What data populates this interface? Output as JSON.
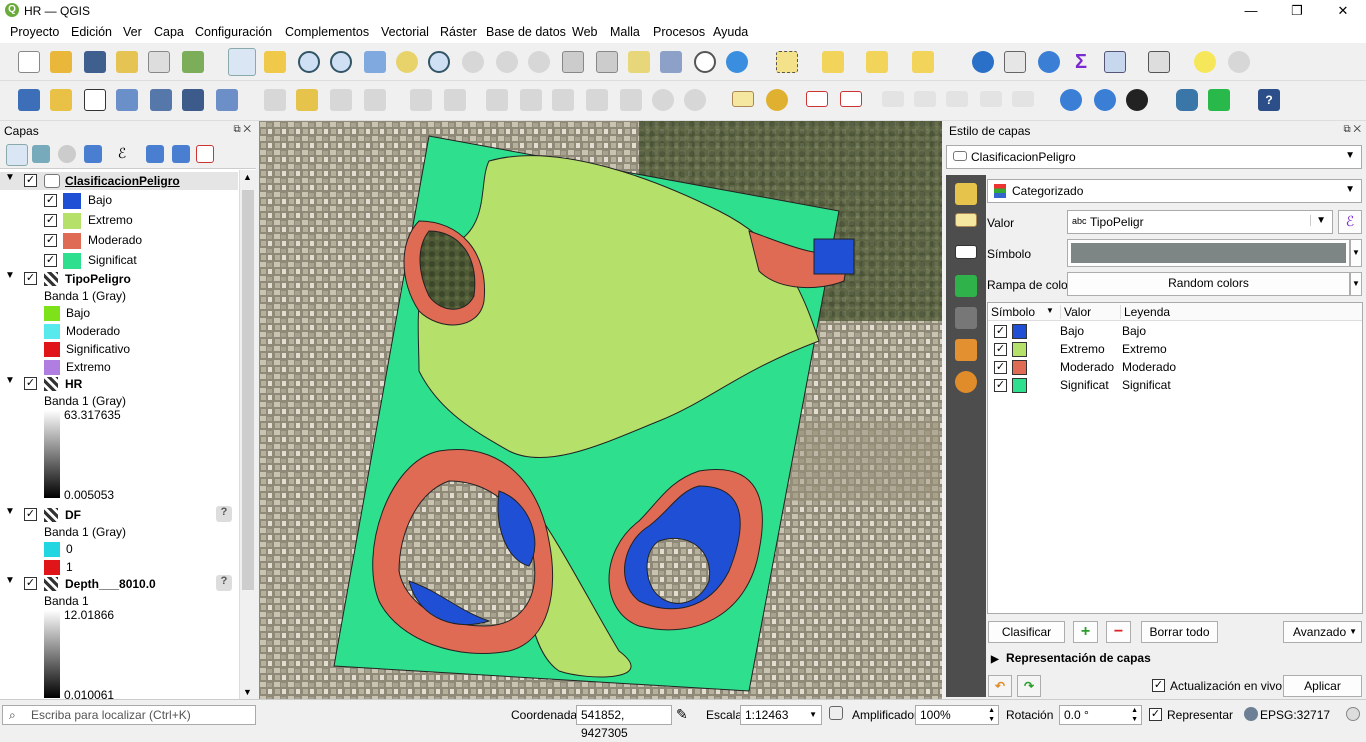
{
  "window": {
    "title": "HR — QGIS",
    "minimize": "—",
    "restore": "❐",
    "close": "✕"
  },
  "menu": [
    "Proyecto",
    "Edición",
    "Ver",
    "Capa",
    "Configuración",
    "Complementos",
    "Vectorial",
    "Ráster",
    "Base de datos",
    "Web",
    "Malla",
    "Procesos",
    "Ayuda"
  ],
  "layers_panel": {
    "title": "Capas",
    "layers": [
      {
        "name": "ClasificacionPeligro",
        "classes": [
          {
            "label": "Bajo",
            "color": "#1f4fd4"
          },
          {
            "label": "Extremo",
            "color": "#b5e06a"
          },
          {
            "label": "Moderado",
            "color": "#e06b55"
          },
          {
            "label": "Significat",
            "color": "#2ee08d"
          }
        ]
      },
      {
        "name": "TipoPeligro",
        "band": "Banda 1 (Gray)",
        "classes": [
          {
            "label": "Bajo",
            "color": "#7ee21a"
          },
          {
            "label": "Moderado",
            "color": "#57e9eb"
          },
          {
            "label": "Significativo",
            "color": "#e0151a"
          },
          {
            "label": "Extremo",
            "color": "#b07ee0"
          }
        ]
      },
      {
        "name": "HR",
        "band": "Banda 1 (Gray)",
        "max": "63.317635",
        "min": "0.005053"
      },
      {
        "name": "DF",
        "band": "Banda 1 (Gray)",
        "classes": [
          {
            "label": "0",
            "color": "#21d6e0"
          },
          {
            "label": "1",
            "color": "#e0151a"
          }
        ]
      },
      {
        "name": "Depth___8010.0",
        "band": "Banda 1",
        "max": "12.01866",
        "min": "0.010061"
      }
    ]
  },
  "style_panel": {
    "title": "Estilo de capas",
    "layer_select": "ClasificacionPeligro",
    "renderer": "Categorizado",
    "value_label": "Valor",
    "value_field": "TipoPeligr",
    "value_prefix": "abc",
    "symbol_label": "Símbolo",
    "ramp_label": "Rampa de color",
    "ramp_value": "Random colors",
    "headers": [
      "Símbolo",
      "Valor",
      "Leyenda"
    ],
    "categories": [
      {
        "value": "Bajo",
        "legend": "Bajo",
        "color": "#1f4fd4"
      },
      {
        "value": "Extremo",
        "legend": "Extremo",
        "color": "#b5e06a"
      },
      {
        "value": "Moderado",
        "legend": "Moderado",
        "color": "#e06b55"
      },
      {
        "value": "Significat",
        "legend": "Significat",
        "color": "#2ee08d"
      }
    ],
    "classify": "Clasificar",
    "delete_all": "Borrar todo",
    "advanced": "Avanzado",
    "layer_rendering": "Representación de capas",
    "live_update": "Actualización en vivo",
    "apply": "Aplicar"
  },
  "statusbar": {
    "locator_placeholder": "Escriba para localizar (Ctrl+K)",
    "coord_label": "Coordenada",
    "coord": "541852, 9427305",
    "scale_label": "Escala",
    "scale": "1:12463",
    "magnifier_label": "Amplificador",
    "magnifier": "100%",
    "rotation_label": "Rotación",
    "rotation": "0.0 °",
    "render_label": "Representar",
    "crs": "EPSG:32717"
  },
  "colors": {
    "bajo": "#1f4fd4",
    "extremo": "#b5e06a",
    "moderado": "#e06b55",
    "significat": "#2ee08d"
  }
}
